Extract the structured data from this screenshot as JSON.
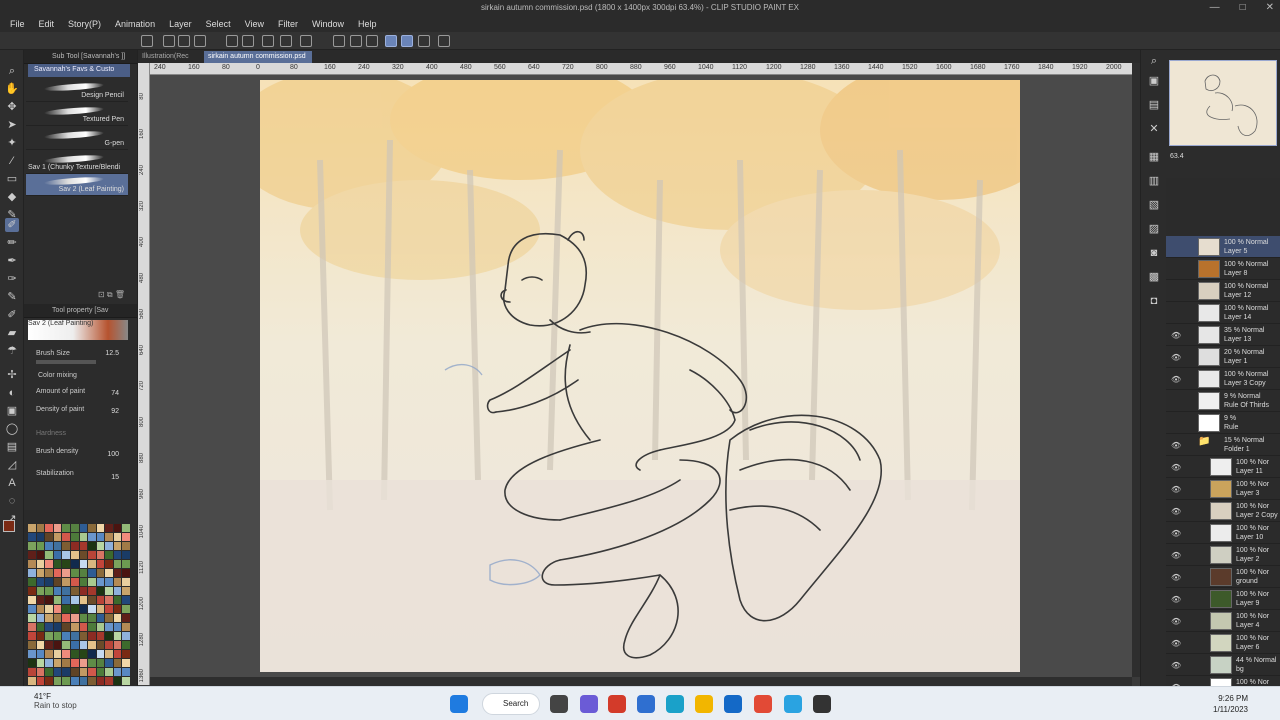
{
  "app": {
    "window_title": "sirkain autumn commission.psd (1800 x 1400px 300dpi 63.4%) - CLIP STUDIO PAINT EX",
    "controls": [
      "—",
      "□",
      "✕"
    ]
  },
  "menu": [
    "File",
    "Edit",
    "Story(P)",
    "Animation",
    "Layer",
    "Select",
    "View",
    "Filter",
    "Window",
    "Help"
  ],
  "subtool": {
    "header": "Sub Tool [Savannah's ]]",
    "tab": "Savannah's Favs & Custo",
    "brushes": [
      {
        "label": "Design Pencil"
      },
      {
        "label": "Textured Pen"
      },
      {
        "label": "G-pen"
      },
      {
        "label": "Sav 1 (Chunky Texture/Blendi"
      },
      {
        "label": "Sav 2 (Leaf Painting)"
      }
    ]
  },
  "tool_property": {
    "header": "Tool property [Sav",
    "brush_name": "Sav 2 (Leaf Painting)",
    "rows": [
      {
        "label": "Brush Size",
        "value": "12.5"
      },
      {
        "label": "Color mixing",
        "value": ""
      },
      {
        "label": "Amount of paint",
        "value": "74"
      },
      {
        "label": "Density of paint",
        "value": "92"
      },
      {
        "label": "Hardness",
        "value": ""
      },
      {
        "label": "Brush density",
        "value": "100"
      },
      {
        "label": "Stabilization",
        "value": "15"
      }
    ]
  },
  "doc_tabs": [
    "Illustration(Rec",
    "sirkain autumn commission.psd"
  ],
  "ruler_top": [
    "240",
    "160",
    "80",
    "0",
    "80",
    "160",
    "240",
    "320",
    "400",
    "480",
    "560",
    "640",
    "720",
    "800",
    "880",
    "960",
    "1040",
    "1120",
    "1200",
    "1280",
    "1360",
    "1440",
    "1520",
    "1600",
    "1680",
    "1760",
    "1840",
    "1920",
    "2000"
  ],
  "ruler_left": [
    "80",
    "160",
    "240",
    "320",
    "400",
    "480",
    "560",
    "640",
    "720",
    "800",
    "880",
    "960",
    "1040",
    "1120",
    "1200",
    "1280",
    "1360"
  ],
  "status": {
    "zoom": "63.4",
    "nav_zoom": "63.4"
  },
  "layers": [
    {
      "opacity": "100 % Normal",
      "name": "Layer 5",
      "thumb": "#e6ddcf",
      "selected": true,
      "eye": false
    },
    {
      "opacity": "100 % Normal",
      "name": "Layer 8",
      "thumb": "#b8722c",
      "selected": false,
      "eye": false
    },
    {
      "opacity": "100 % Normal",
      "name": "Layer 12",
      "thumb": "#d8cfbf",
      "selected": false,
      "eye": false
    },
    {
      "opacity": "100 % Normal",
      "name": "Layer 14",
      "thumb": "#e8e8e8",
      "selected": false,
      "eye": false
    },
    {
      "opacity": "35 % Normal",
      "name": "Layer 13",
      "thumb": "#e6e6e6",
      "selected": false,
      "eye": true
    },
    {
      "opacity": "20 % Normal",
      "name": "Layer 1",
      "thumb": "#dedede",
      "selected": false,
      "eye": true
    },
    {
      "opacity": "100 % Normal",
      "name": "Layer 3 Copy",
      "thumb": "#e9e9e9",
      "selected": false,
      "eye": true
    },
    {
      "opacity": "9 % Normal",
      "name": "Rule Of Thirds",
      "thumb": "#f0f0f0",
      "selected": false,
      "eye": false
    },
    {
      "opacity": "9 %",
      "name": "Rule",
      "thumb": "#ffffff",
      "selected": false,
      "eye": false
    },
    {
      "opacity": "15 % Normal",
      "name": "Folder 1",
      "thumb": "",
      "selected": false,
      "eye": true
    },
    {
      "opacity": "100 % Nor",
      "name": "Layer 11",
      "thumb": "#eeeeee",
      "selected": false,
      "eye": true
    },
    {
      "opacity": "100 % Nor",
      "name": "Layer 3",
      "thumb": "#caa35c",
      "selected": false,
      "eye": true
    },
    {
      "opacity": "100 % Nor",
      "name": "Layer 2 Copy",
      "thumb": "#d9d0c0",
      "selected": false,
      "eye": true
    },
    {
      "opacity": "100 % Nor",
      "name": "Layer 10",
      "thumb": "#ececec",
      "selected": false,
      "eye": true
    },
    {
      "opacity": "100 % Nor",
      "name": "Layer 2",
      "thumb": "#cfcfc2",
      "selected": false,
      "eye": true
    },
    {
      "opacity": "100 % Nor",
      "name": "ground",
      "thumb": "#5b3b2b",
      "selected": false,
      "eye": true
    },
    {
      "opacity": "100 % Nor",
      "name": "Layer 9",
      "thumb": "#3d5a2a",
      "selected": false,
      "eye": true
    },
    {
      "opacity": "100 % Nor",
      "name": "Layer 4",
      "thumb": "#c4c8b0",
      "selected": false,
      "eye": true
    },
    {
      "opacity": "100 % Nor",
      "name": "Layer 6",
      "thumb": "#d2d6bf",
      "selected": false,
      "eye": true
    },
    {
      "opacity": "44 % Normal",
      "name": "bg",
      "thumb": "#c7d2c4",
      "selected": false,
      "eye": true
    },
    {
      "opacity": "100 % Nor",
      "name": "",
      "thumb": "#ffffff",
      "selected": false,
      "eye": true
    }
  ],
  "taskbar": {
    "weather_temp": "41°F",
    "weather_text": "Rain to stop",
    "search_label": "Search",
    "time": "9:26 PM",
    "date": "1/11/2023",
    "apps": [
      "windows-start",
      "search",
      "file-explorer",
      "chat",
      "office",
      "store",
      "edge",
      "folder",
      "mail",
      "chrome",
      "telegram",
      "clip-studio"
    ]
  },
  "colors": {
    "main_color": "#7a2a14",
    "accent": "#5a6f98"
  }
}
